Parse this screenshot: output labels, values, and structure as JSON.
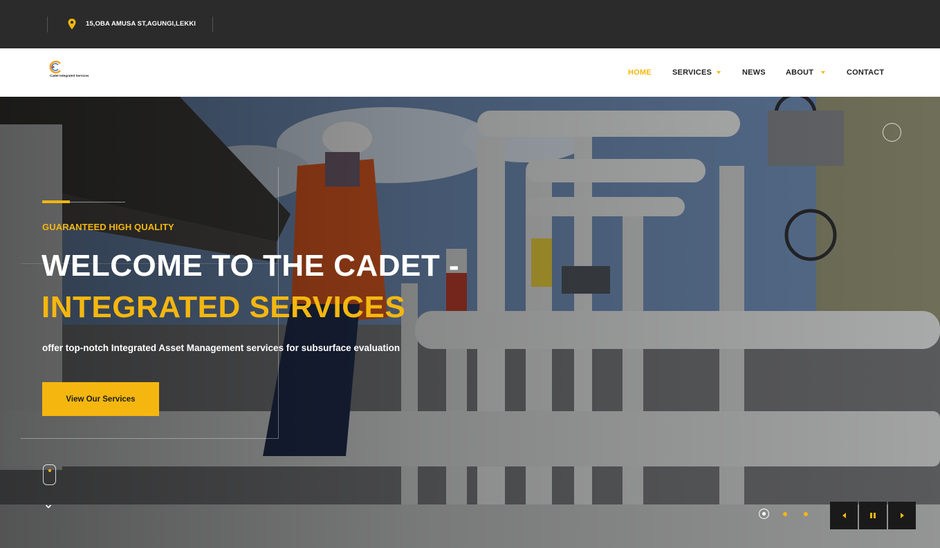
{
  "topbar": {
    "address": "15,OBA AMUSA ST,AGUNGI,LEKKI",
    "address_icon": "map-pin-icon"
  },
  "header": {
    "logo_text": "Cadet Integrated  Services",
    "nav": [
      {
        "label": "HOME",
        "active": true,
        "has_dropdown": false
      },
      {
        "label": "SERVICES",
        "active": false,
        "has_dropdown": true
      },
      {
        "label": "NEWS",
        "active": false,
        "has_dropdown": false
      },
      {
        "label": "ABOUT",
        "active": false,
        "has_dropdown": true
      },
      {
        "label": "CONTACT",
        "active": false,
        "has_dropdown": false
      }
    ]
  },
  "hero": {
    "eyebrow": "GUARANTEED HIGH QUALITY",
    "title_line1": "WELCOME TO THE CADET -",
    "title_line2": "INTEGRATED SERVICES",
    "subtitle": "offer top-notch Integrated Asset Management services for subsurface evaluation",
    "cta_label": "View Our Services",
    "slides_total": 3,
    "active_slide": 1
  },
  "colors": {
    "accent": "#f5b70f",
    "topbar_bg": "#2b2b2b",
    "header_bg": "#ffffff",
    "control_bg": "#1a1a1a"
  }
}
